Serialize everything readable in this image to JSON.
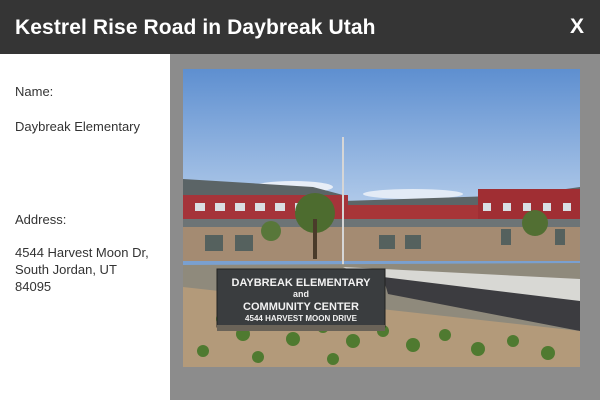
{
  "window": {
    "title": "Kestrel Rise Road in Daybreak Utah",
    "close_label": "X"
  },
  "details": {
    "name_label": "Name:",
    "name_value": "Daybreak Elementary",
    "address_label": "Address:",
    "address_lines": [
      "4544 Harvest Moon Dr,",
      "South Jordan, UT",
      "84095"
    ]
  },
  "photo": {
    "sign_lines": [
      "DAYBREAK ELEMENTARY",
      "and",
      "COMMUNITY CENTER",
      "4544 HARVEST MOON DRIVE"
    ]
  }
}
